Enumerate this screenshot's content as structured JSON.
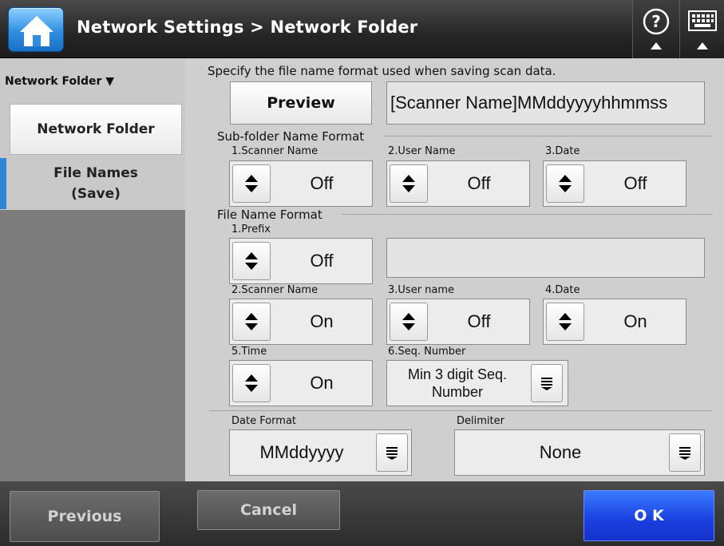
{
  "header": {
    "title": "Network Settings > Network Folder",
    "icons": [
      "home-icon",
      "help-icon",
      "keyboard-icon"
    ]
  },
  "sidebar": {
    "heading": "Network Folder ▼",
    "items": [
      {
        "label": "Network Folder",
        "active": false
      },
      {
        "label": "File Names\n(Save)",
        "active": true
      }
    ]
  },
  "main": {
    "instruction": "Specify the file name format used when saving scan data.",
    "preview_label": "Preview",
    "preview_value": "[Scanner Name]MMddyyyyhhmmss",
    "subfolder": {
      "title": "Sub-folder Name Format",
      "fields": [
        {
          "label": "1.Scanner Name",
          "value": "Off"
        },
        {
          "label": "2.User Name",
          "value": "Off"
        },
        {
          "label": "3.Date",
          "value": "Off"
        }
      ]
    },
    "filename": {
      "title": "File Name Format",
      "prefix": {
        "label": "1.Prefix",
        "value": "Off",
        "text": ""
      },
      "fields": [
        {
          "label": "2.Scanner Name",
          "value": "On"
        },
        {
          "label": "3.User name",
          "value": "Off"
        },
        {
          "label": "4.Date",
          "value": "On"
        },
        {
          "label": "5.Time",
          "value": "On"
        }
      ],
      "seq": {
        "label": "6.Seq. Number",
        "value": "Min 3 digit Seq. Number"
      }
    },
    "date_format": {
      "label": "Date Format",
      "value": "MMddyyyy"
    },
    "delimiter": {
      "label": "Delimiter",
      "value": "None"
    }
  },
  "footer": {
    "previous_label": "Previous",
    "cancel_label": "Cancel",
    "ok_label": "O K"
  },
  "colors": {
    "accent": "#2f86d6",
    "ok_button": "#1a3fe0"
  }
}
